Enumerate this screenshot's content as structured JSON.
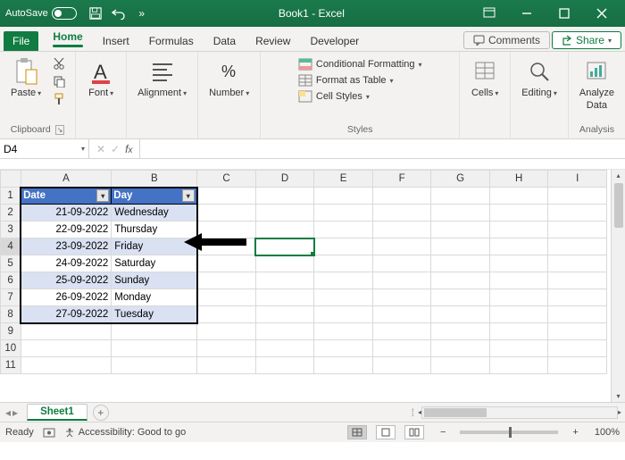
{
  "titlebar": {
    "autosave_label": "AutoSave",
    "autosave_state": "Off",
    "doc_title": "Book1 - Excel"
  },
  "tabs": {
    "file": "File",
    "home": "Home",
    "insert": "Insert",
    "formulas": "Formulas",
    "data": "Data",
    "review": "Review",
    "developer": "Developer",
    "comments": "Comments",
    "share": "Share"
  },
  "ribbon": {
    "paste": "Paste",
    "clipboard": "Clipboard",
    "font": "Font",
    "alignment": "Alignment",
    "number": "Number",
    "cond_fmt": "Conditional Formatting",
    "fmt_table": "Format as Table",
    "cell_styles": "Cell Styles",
    "styles": "Styles",
    "cells": "Cells",
    "editing": "Editing",
    "analyze": "Analyze",
    "analyze2": "Data",
    "analysis": "Analysis"
  },
  "namebox": {
    "ref": "D4"
  },
  "columns": [
    "A",
    "B",
    "C",
    "D",
    "E",
    "F",
    "G",
    "H",
    "I"
  ],
  "table": {
    "headers": {
      "date": "Date",
      "day": "Day"
    },
    "rows": [
      {
        "date": "21-09-2022",
        "day": "Wednesday"
      },
      {
        "date": "22-09-2022",
        "day": "Thursday"
      },
      {
        "date": "23-09-2022",
        "day": "Friday"
      },
      {
        "date": "24-09-2022",
        "day": "Saturday"
      },
      {
        "date": "25-09-2022",
        "day": "Sunday"
      },
      {
        "date": "26-09-2022",
        "day": "Monday"
      },
      {
        "date": "27-09-2022",
        "day": "Tuesday"
      }
    ]
  },
  "sheets": {
    "active": "Sheet1"
  },
  "status": {
    "ready": "Ready",
    "accessibility": "Accessibility: Good to go",
    "zoom": "100%"
  }
}
